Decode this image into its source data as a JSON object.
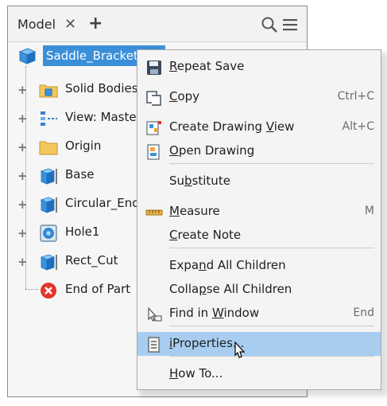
{
  "browser": {
    "tab_label": "Model",
    "close_glyph": "✕",
    "add_glyph": "+",
    "root": {
      "label": "Saddle_Bracket"
    },
    "items": [
      {
        "label": "Solid Bodies",
        "icon": "folder-solid-bodies-icon",
        "expander": "+"
      },
      {
        "label": "View: Master",
        "icon": "view-icon",
        "expander": "+"
      },
      {
        "label": "Origin",
        "icon": "folder-icon",
        "expander": "+"
      },
      {
        "label": "Base",
        "icon": "extrude-feature-icon",
        "expander": "+"
      },
      {
        "label": "Circular_End",
        "icon": "extrude-feature-icon",
        "expander": "+"
      },
      {
        "label": "Hole1",
        "icon": "hole-feature-icon",
        "expander": "+"
      },
      {
        "label": "Rect_Cut",
        "icon": "extrude-feature-icon",
        "expander": "+"
      },
      {
        "label": "End of Part",
        "icon": "end-of-part-icon",
        "expander": ""
      }
    ]
  },
  "context_menu": {
    "items": [
      {
        "pre": "",
        "u": "R",
        "post": "epeat Save",
        "shortcut": "",
        "icon": "save-icon"
      },
      {
        "pre": "",
        "u": "C",
        "post": "opy",
        "shortcut": "Ctrl+C",
        "icon": "copy-icon"
      },
      {
        "pre": "Create Drawing ",
        "u": "V",
        "post": "iew",
        "shortcut": "Alt+C",
        "icon": "create-drawing-view-icon"
      },
      {
        "pre": "",
        "u": "O",
        "post": "pen Drawing",
        "shortcut": "",
        "icon": "open-drawing-icon"
      },
      {
        "pre": "Su",
        "u": "b",
        "post": "stitute",
        "shortcut": "",
        "icon": ""
      },
      {
        "pre": "",
        "u": "M",
        "post": "easure",
        "shortcut": "M",
        "icon": "measure-icon"
      },
      {
        "pre": "",
        "u": "C",
        "post": "reate Note",
        "shortcut": "",
        "icon": ""
      },
      {
        "pre": "Expa",
        "u": "n",
        "post": "d All Children",
        "shortcut": "",
        "icon": ""
      },
      {
        "pre": "Colla",
        "u": "p",
        "post": "se All Children",
        "shortcut": "",
        "icon": ""
      },
      {
        "pre": "Find in ",
        "u": "W",
        "post": "indow",
        "shortcut": "End",
        "icon": "find-in-window-icon"
      },
      {
        "pre": "",
        "u": "i",
        "post": "Properties...",
        "shortcut": "",
        "icon": "iproperties-icon"
      },
      {
        "pre": "",
        "u": "H",
        "post": "ow To...",
        "shortcut": "",
        "icon": ""
      }
    ]
  }
}
